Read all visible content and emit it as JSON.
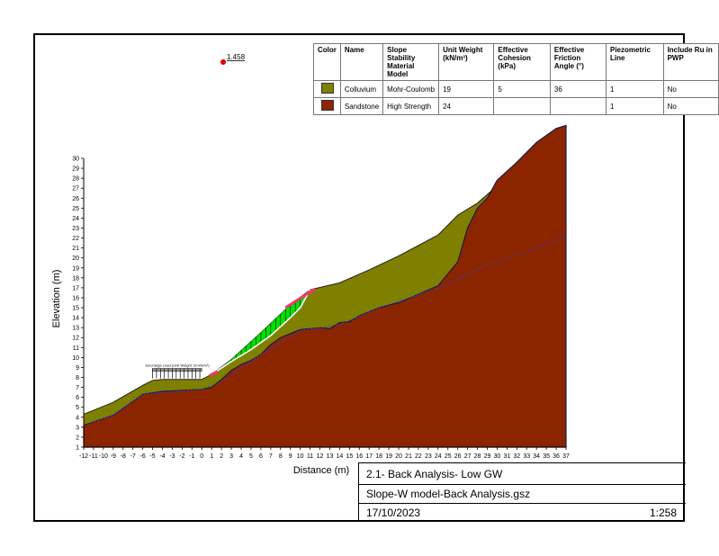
{
  "factor_of_safety": "1.458",
  "materials": {
    "headers": [
      "Color",
      "Name",
      "Slope Stability Material Model",
      "Unit Weight (kN/m³)",
      "Effective Cohesion (kPa)",
      "Effective Friction Angle (°)",
      "Piezometric Line",
      "Include Ru in PWP"
    ],
    "rows": [
      {
        "color": "#808000",
        "name": "Colluvium",
        "model": "Mohr-Coulomb",
        "unit_weight": "19",
        "cohesion": "5",
        "friction": "36",
        "piezo": "1",
        "ru": "No"
      },
      {
        "color": "#8B2500",
        "name": "Sandstone",
        "model": "High Strength",
        "unit_weight": "24",
        "cohesion": "",
        "friction": "",
        "piezo": "1",
        "ru": "No"
      }
    ]
  },
  "axes": {
    "xlabel": "Distance (m)",
    "ylabel": "Elevation (m)",
    "xlim": [
      -12,
      37
    ],
    "ylim": [
      1,
      30
    ]
  },
  "load_label": "Surcharge Load (Unit Weight: 20 kN/m³)",
  "title_block": {
    "title": "2.1- Back Analysis- Low GW",
    "file": "Slope-W model-Back Analysis.gsz",
    "date": "17/10/2023",
    "scale": "1:258"
  },
  "colors": {
    "colluvium": "#808000",
    "sandstone": "#8B2500",
    "slices": "#00e000",
    "piezometric": "#3a3ad0",
    "slip_surface": "#ffffff",
    "fos_marker": "#e00000"
  }
}
